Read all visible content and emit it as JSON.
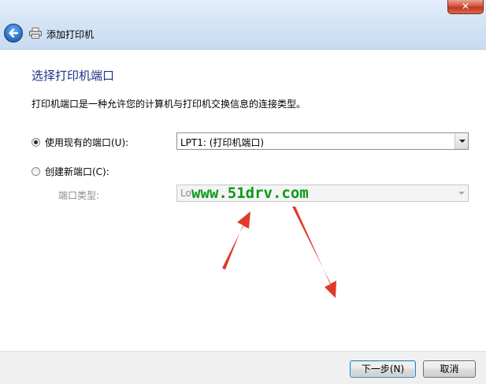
{
  "window": {
    "title": "添加打印机",
    "close_label": "✕"
  },
  "main": {
    "heading": "选择打印机端口",
    "description": "打印机端口是一种允许您的计算机与打印机交换信息的连接类型。",
    "use_existing": {
      "label": "使用现有的端口(U):",
      "selected": true,
      "value": "LPT1: (打印机端口)"
    },
    "create_new": {
      "label": "创建新端口(C):",
      "selected": false,
      "port_type_label": "端口类型:",
      "port_type_value": "Lo"
    },
    "watermark": "www.51drv.com"
  },
  "footer": {
    "next_label": "下一步(N)",
    "cancel_label": "取消"
  },
  "colors": {
    "heading": "#1e3287",
    "watermark": "#0a9a18",
    "arrow": "#e0392b"
  }
}
